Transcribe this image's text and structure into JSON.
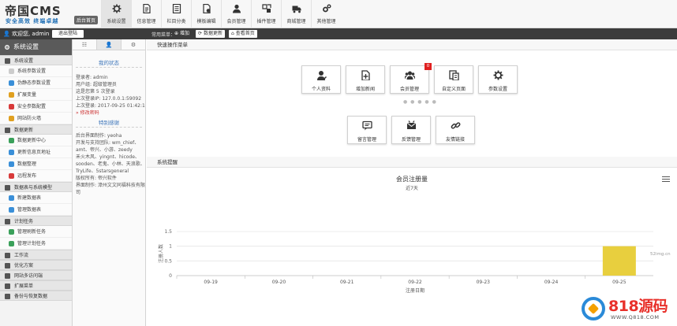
{
  "header": {
    "logo_title": "帝国CMS",
    "logo_sub": "安全高效 终端卓越",
    "home_label": "后台首页",
    "nav": [
      {
        "label": "系统设置",
        "icon": "gear-icon"
      },
      {
        "label": "信息管理",
        "icon": "document-icon"
      },
      {
        "label": "栏目分类",
        "icon": "list-icon"
      },
      {
        "label": "模板编辑",
        "icon": "template-icon"
      },
      {
        "label": "会员管理",
        "icon": "user-icon"
      },
      {
        "label": "插件管理",
        "icon": "plugin-icon"
      },
      {
        "label": "商城管理",
        "icon": "truck-icon"
      },
      {
        "label": "其他管理",
        "icon": "gears-icon"
      }
    ]
  },
  "bar": {
    "welcome": "欢迎您, admin",
    "logout": "退出登陆",
    "common_label": "常用菜单：",
    "add_label": "增加",
    "update_label": "数据更新",
    "home_label": "查看首页"
  },
  "sidebar": {
    "title": "系统设置",
    "groups": [
      {
        "label": "系统设置",
        "items": [
          {
            "label": "系统参数设置",
            "color": "#cccccc"
          },
          {
            "label": "伪静态参数设置",
            "color": "#3a8fd8"
          },
          {
            "label": "扩展变量",
            "color": "#e0a020"
          },
          {
            "label": "安全参数配置",
            "color": "#d83a3a"
          },
          {
            "label": "网站防火墙",
            "color": "#e0a020"
          }
        ]
      },
      {
        "label": "数据更新",
        "items": [
          {
            "label": "数据更新中心",
            "color": "#3aa05a"
          },
          {
            "label": "更新信息页地址",
            "color": "#3a8fd8"
          },
          {
            "label": "数据整理",
            "color": "#3a8fd8"
          },
          {
            "label": "远程发布",
            "color": "#d83a3a"
          }
        ]
      },
      {
        "label": "数据表与系统模型",
        "items": [
          {
            "label": "新建数据表",
            "color": "#3a8fd8"
          },
          {
            "label": "管理数据表",
            "color": "#3a8fd8"
          }
        ]
      },
      {
        "label": "计划任务",
        "items": [
          {
            "label": "管理刷新任务",
            "color": "#3aa05a"
          },
          {
            "label": "管理计划任务",
            "color": "#3aa05a"
          }
        ]
      },
      {
        "label": "工作流",
        "items": []
      },
      {
        "label": "优化方案",
        "items": []
      },
      {
        "label": "网站多访问端",
        "items": []
      },
      {
        "label": "扩展菜单",
        "items": []
      },
      {
        "label": "备份与恢复数据",
        "items": []
      }
    ]
  },
  "info": {
    "tabs": [
      "☷",
      "👤",
      "⚙"
    ],
    "status_title": "我的状态",
    "status_lines": [
      "登录者: admin",
      "用户组: 超级管理员",
      "这是您第 5 次登录",
      "上次登录IP: 127.0.0.1:59092",
      "上次登录: 2017-09-25 01:42:14"
    ],
    "change_password": "» 修改密码",
    "thanks_title": "特别感谢",
    "thanks_lines": [
      "后台界面制作: yeoha",
      "开发与支持团队: wm_chief、",
      "amt、帝兴、小游、zeedy",
      "禾火木风、yingnt、hicode、",
      "sooden、老鬼、小林、天浪歌、",
      "TryLife、5starsgeneral",
      "版权所有: 帝兴软件",
      "界面制作: 漳州文文同福科技有限公",
      "司"
    ]
  },
  "main": {
    "quick_title": "快速操作菜单",
    "quick_row1": [
      {
        "label": "个人资料",
        "icon": "user-edit-icon",
        "badge": ""
      },
      {
        "label": "增加新闻",
        "icon": "add-news-icon",
        "badge": ""
      },
      {
        "label": "会员管理",
        "icon": "users-icon",
        "badge": "0"
      },
      {
        "label": "自定义页面",
        "icon": "custom-page-icon",
        "badge": ""
      },
      {
        "label": "参数设置",
        "icon": "gear-icon",
        "badge": ""
      }
    ],
    "quick_row2": [
      {
        "label": "留言管理",
        "icon": "message-icon",
        "badge": ""
      },
      {
        "label": "反馈管理",
        "icon": "feedback-icon",
        "badge": ""
      },
      {
        "label": "友情链接",
        "icon": "link-icon",
        "badge": ""
      }
    ],
    "reminder_title": "系统提醒",
    "credit": "52img.cn"
  },
  "chart_data": {
    "type": "bar",
    "title": "会员注册量",
    "subtitle": "近7天",
    "xlabel": "注册日期",
    "ylabel": "注册人数",
    "categories": [
      "09-19",
      "09-20",
      "09-21",
      "09-22",
      "09-23",
      "09-24",
      "09-25"
    ],
    "series": [
      {
        "values": [
          0,
          0,
          0,
          0,
          0,
          0,
          1
        ]
      }
    ],
    "yticks": [
      "0",
      "0.5",
      "1",
      "1.5"
    ],
    "ylim": [
      0,
      1.5
    ],
    "bar_color": "#e8cf3e",
    "grid": true
  },
  "watermark": {
    "text": "818源码",
    "url": "WWW.Q818.COM"
  }
}
